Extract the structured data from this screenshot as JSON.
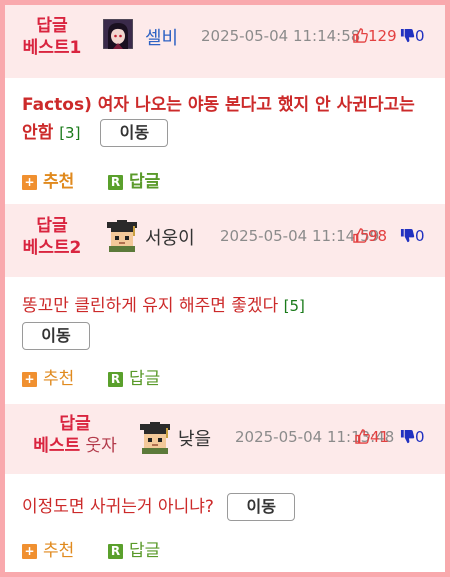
{
  "colors": {
    "page_border": "#f9a9ad",
    "header_bg": "#fdeaea",
    "rank_text": "#d9243f",
    "title_text": "#cc2a2a",
    "reply_count": "#1a7a1a",
    "like_icon": "#e34040",
    "dislike_icon": "#2030c0",
    "recommend_icon": "#f09030",
    "reply_icon": "#5aa02c"
  },
  "posts": [
    {
      "rank_line1": "답글",
      "rank_line2": "베스트1",
      "rank_line2_tail": "",
      "nickname": "셀비",
      "nickname_color": "#2f63c4",
      "avatar_icon": "anime-girl-avatar-icon",
      "datetime": "2025-05-04 11:14:58",
      "likes": "129",
      "dislikes": "0",
      "title": "Factos) 여자 나오는 야동 본다고 했지 안 사귄다고는 안함",
      "reply_count": "[3]",
      "move_label": "이동",
      "recommend_label": "추천",
      "reply_label": "답글"
    },
    {
      "rank_line1": "답글",
      "rank_line2": "베스트2",
      "rank_line2_tail": "",
      "nickname": "서웅이",
      "nickname_color": "#333333",
      "avatar_icon": "pixel-graduate-avatar-icon",
      "datetime": "2025-05-04 11:14:59",
      "likes": "98",
      "dislikes": "0",
      "title": "똥꼬만 클린하게 유지 해주면 좋겠다",
      "reply_count": "[5]",
      "move_label": "이동",
      "recommend_label": "추천",
      "reply_label": "답글"
    },
    {
      "rank_line1": "답글",
      "rank_line2": "베스트",
      "rank_line2_tail": " 웃자",
      "nickname": "낮을",
      "nickname_color": "#333333",
      "avatar_icon": "pixel-graduate-avatar-icon",
      "datetime": "2025-05-04 11:13:48",
      "likes": "41",
      "dislikes": "0",
      "title": "이정도면 사귀는거 아니냐?",
      "reply_count": "",
      "move_label": "이동",
      "recommend_label": "추천",
      "reply_label": "답글"
    }
  ]
}
